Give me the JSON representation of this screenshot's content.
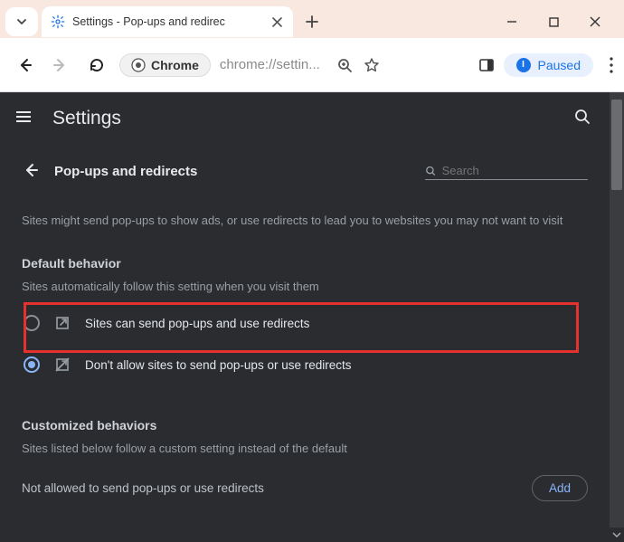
{
  "window": {
    "tab_title": "Settings - Pop-ups and redirec",
    "minimize": "—",
    "maximize": "▢",
    "close": "✕"
  },
  "toolbar": {
    "chrome_label": "Chrome",
    "url": "chrome://settin...",
    "paused_label": "Paused",
    "avatar_initial": "I"
  },
  "settings": {
    "app_title": "Settings",
    "page_title": "Pop-ups and redirects",
    "search_placeholder": "Search",
    "description": "Sites might send pop-ups to show ads, or use redirects to lead you to websites you may not want to visit",
    "default_behavior_heading": "Default behavior",
    "default_behavior_sub": "Sites automatically follow this setting when you visit them",
    "option_allow": "Sites can send pop-ups and use redirects",
    "option_block": "Don't allow sites to send pop-ups or use redirects",
    "selected_option": "block",
    "customized_heading": "Customized behaviors",
    "customized_sub": "Sites listed below follow a custom setting instead of the default",
    "not_allowed_label": "Not allowed to send pop-ups or use redirects",
    "add_button": "Add"
  }
}
